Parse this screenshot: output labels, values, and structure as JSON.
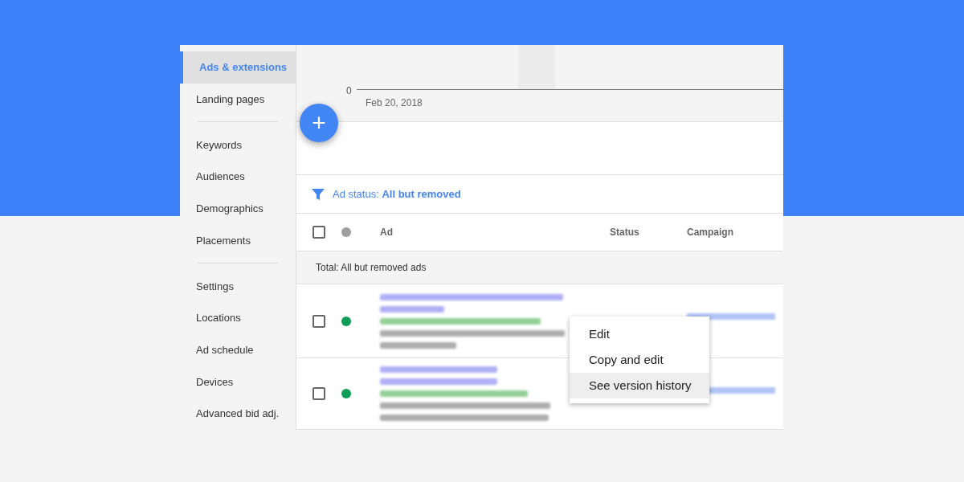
{
  "sidebar": {
    "groups": [
      [
        {
          "label": "Ads & extensions",
          "selected": true
        },
        {
          "label": "Landing pages",
          "selected": false
        }
      ],
      [
        {
          "label": "Keywords",
          "selected": false
        },
        {
          "label": "Audiences",
          "selected": false
        },
        {
          "label": "Demographics",
          "selected": false
        },
        {
          "label": "Placements",
          "selected": false
        }
      ],
      [
        {
          "label": "Settings",
          "selected": false
        },
        {
          "label": "Locations",
          "selected": false
        },
        {
          "label": "Ad schedule",
          "selected": false
        },
        {
          "label": "Devices",
          "selected": false
        },
        {
          "label": "Advanced bid adj.",
          "selected": false
        }
      ]
    ]
  },
  "chart": {
    "y_tick": "0",
    "x_label": "Feb 20, 2018"
  },
  "add_button": {
    "label": "+"
  },
  "filter": {
    "label": "Ad status: ",
    "value": "All but removed"
  },
  "table": {
    "columns": [
      "Ad",
      "Status",
      "Campaign"
    ],
    "header_checked": false,
    "total_label": "Total: All but removed ads",
    "rows": [
      {
        "checked": false,
        "color": "#0f9d58"
      },
      {
        "checked": false,
        "color": "#0f9d58"
      }
    ]
  },
  "context_menu": [
    {
      "label": "Edit",
      "selected": false
    },
    {
      "label": "Copy and edit",
      "selected": false
    },
    {
      "label": "See version history",
      "selected": true
    }
  ]
}
